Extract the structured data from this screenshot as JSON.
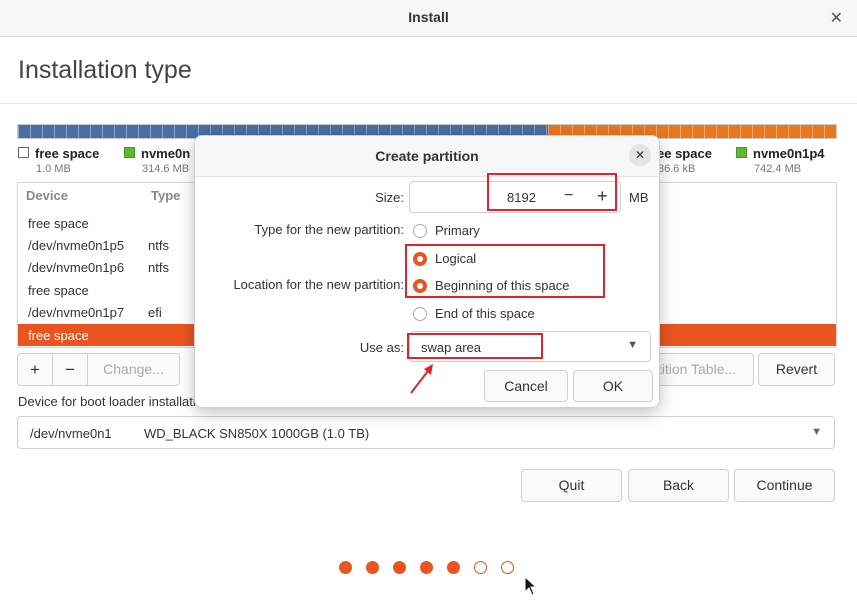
{
  "window": {
    "title": "Install"
  },
  "page": {
    "title": "Installation type"
  },
  "disk_legend": [
    {
      "name": "free space",
      "size": "1.0 MB"
    },
    {
      "name": "nvme0n",
      "size": "314.6 MB"
    },
    {
      "name": "ee space",
      "size": "36.6 kB"
    },
    {
      "name": "nvme0n1p4",
      "size": "742.4 MB"
    }
  ],
  "table": {
    "headers": [
      "Device",
      "Type"
    ],
    "rows": [
      {
        "device": "free space",
        "type": ""
      },
      {
        "device": "/dev/nvme0n1p5",
        "type": "ntfs"
      },
      {
        "device": "/dev/nvme0n1p6",
        "type": "ntfs"
      },
      {
        "device": "free space",
        "type": ""
      },
      {
        "device": "/dev/nvme0n1p7",
        "type": "efi"
      },
      {
        "device": "free space",
        "type": ""
      }
    ]
  },
  "toolbar": {
    "add": "+",
    "remove": "−",
    "change": "Change...",
    "new_table": "tition Table...",
    "revert": "Revert"
  },
  "boot": {
    "label": "Device for boot loader installation:",
    "device": "/dev/nvme0n1",
    "model": "WD_BLACK SN850X 1000GB (1.0 TB)"
  },
  "nav": {
    "quit": "Quit",
    "back": "Back",
    "continue": "Continue"
  },
  "progress": {
    "total": 7,
    "completed": 5
  },
  "dialog": {
    "title": "Create partition",
    "size_label": "Size:",
    "size_value": "8192",
    "size_unit": "MB",
    "minus": "−",
    "plus": "+",
    "type_label": "Type for the new partition:",
    "type_options": [
      "Primary",
      "Logical"
    ],
    "type_selected": "Logical",
    "location_label": "Location for the new partition:",
    "location_options": [
      "Beginning of this space",
      "End of this space"
    ],
    "location_selected": "Beginning of this space",
    "use_as_label": "Use as:",
    "use_as_value": "swap area",
    "cancel": "Cancel",
    "ok": "OK"
  },
  "colors": {
    "accent": "#e95420",
    "partition_blue": "#4a6fa5",
    "partition_orange": "#e8771e",
    "annotation_red": "#e0242b"
  }
}
